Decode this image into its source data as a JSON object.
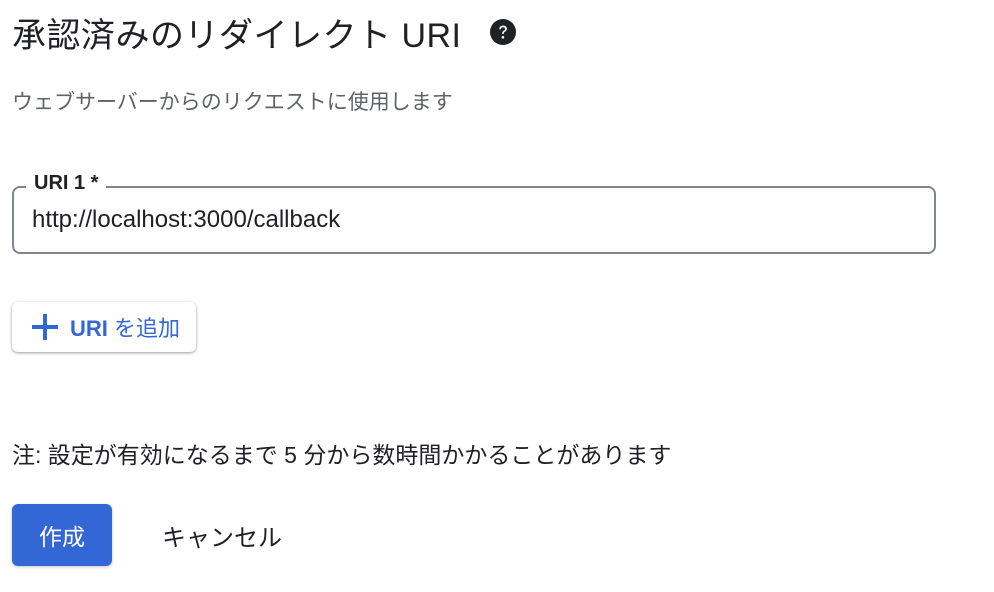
{
  "header": {
    "title": "承認済みのリダイレクト URI",
    "help_icon": "question-circle-icon"
  },
  "subtitle": "ウェブサーバーからのリクエストに使用します",
  "uri_field": {
    "label": "URI 1 *",
    "value": "http://localhost:3000/callback"
  },
  "add_button": {
    "icon": "plus-icon",
    "label_bold": "URI",
    "label_rest": " を追加"
  },
  "note": "注: 設定が有効になるまで 5 分から数時間かかることがあります",
  "actions": {
    "create_label": "作成",
    "cancel_label": "キャンセル"
  },
  "colors": {
    "primary": "#3367d6",
    "text": "#202124",
    "secondary_text": "#5f6368",
    "border": "#80868b"
  }
}
